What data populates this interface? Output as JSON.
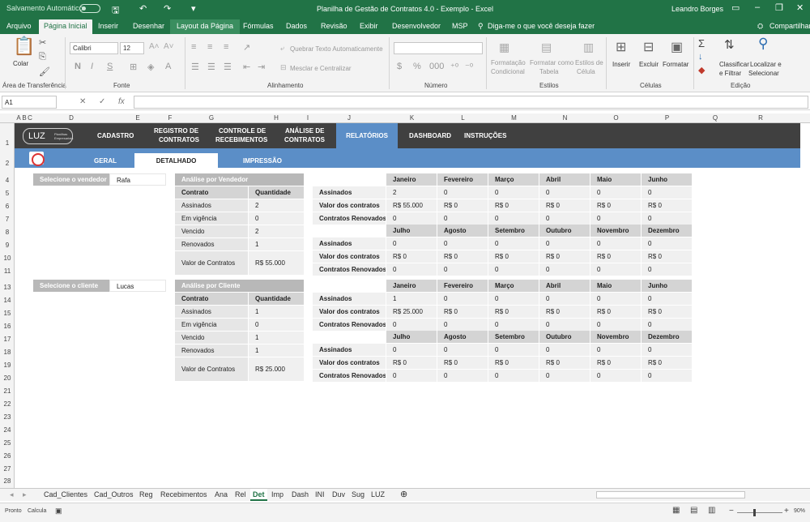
{
  "titlebar": {
    "autosave": "Salvamento Automático",
    "title": "Planilha de Gestão de Contratos 4.0 - Exemplo  -  Excel",
    "user": "Leandro Borges"
  },
  "tabs": [
    "Arquivo",
    "Página Inicial",
    "Inserir",
    "Desenhar",
    "Layout da Página",
    "Fórmulas",
    "Dados",
    "Revisão",
    "Exibir",
    "Desenvolvedor",
    "MSP"
  ],
  "search": "Diga-me o que você deseja fazer",
  "share": "Compartilhar",
  "ribbon": {
    "paste": "Colar",
    "clipboard": "Área de Transferência",
    "font_name": "Calibri",
    "font_size": "12",
    "font_group": "Fonte",
    "wrap": "Quebrar Texto Automaticamente",
    "merge": "Mesclar e Centralizar",
    "align_group": "Alinhamento",
    "number_group": "Número",
    "cond_format_1": "Formatação",
    "cond_format_2": "Condicional",
    "format_table_1": "Formatar como",
    "format_table_2": "Tabela",
    "cell_styles_1": "Estilos de",
    "cell_styles_2": "Célula",
    "styles_group": "Estilos",
    "insert": "Inserir",
    "delete": "Excluir",
    "format": "Formatar",
    "cells_group": "Células",
    "sort_1": "Classificar",
    "sort_2": "e Filtrar",
    "find_1": "Localizar e",
    "find_2": "Selecionar",
    "edit_group": "Edição"
  },
  "namebox": "A1",
  "columns": [
    "A",
    "B",
    "C",
    "D",
    "E",
    "F",
    "G",
    "H",
    "I",
    "J",
    "K",
    "L",
    "M",
    "N",
    "O",
    "P",
    "Q",
    "R"
  ],
  "rows": [
    "1",
    "2",
    "4",
    "5",
    "6",
    "7",
    "8",
    "9",
    "10",
    "11",
    "13",
    "14",
    "15",
    "16",
    "17",
    "18",
    "19",
    "20",
    "21",
    "22",
    "23",
    "24",
    "25",
    "26",
    "27",
    "28",
    "29",
    "30"
  ],
  "nav": {
    "logo": "LUZ",
    "logo_sub": "Planilhas Empresariais",
    "cadastro": "CADASTRO",
    "registro_1": "REGISTRO DE",
    "registro_2": "CONTRATOS",
    "controle_1": "CONTROLE DE",
    "controle_2": "RECEBIMENTOS",
    "analise_1": "ANÁLISE DE",
    "analise_2": "CONTRATOS",
    "relatorios": "RELATÓRIOS",
    "dashboard": "DASHBOARD",
    "instrucoes": "INSTRUÇÕES"
  },
  "subnav": {
    "geral": "GERAL",
    "detalhado": "DETALHADO",
    "impressao": "IMPRESSÃO"
  },
  "sel_vendor_label": "Selecione o vendedor",
  "sel_vendor_value": "Rafa",
  "sel_client_label": "Selecione o cliente",
  "sel_client_value": "Lucas",
  "vendor_table": {
    "title": "Análise por Vendedor",
    "h1": "Contrato",
    "h2": "Quantidade",
    "rows": [
      [
        "Assinados",
        "2"
      ],
      [
        "Em vigência",
        "0"
      ],
      [
        "Vencido",
        "2"
      ],
      [
        "Renovados",
        "1"
      ]
    ],
    "valor_label": "Valor de Contratos",
    "valor": "R$ 55.000"
  },
  "client_table": {
    "title": "Análise por Cliente",
    "h1": "Contrato",
    "h2": "Quantidade",
    "rows": [
      [
        "Assinados",
        "1"
      ],
      [
        "Em vigência",
        "0"
      ],
      [
        "Vencido",
        "1"
      ],
      [
        "Renovados",
        "1"
      ]
    ],
    "valor_label": "Valor de Contratos",
    "valor": "R$ 25.000"
  },
  "months_1": [
    "Janeiro",
    "Fevereiro",
    "Março",
    "Abril",
    "Maio",
    "Junho"
  ],
  "months_2": [
    "Julho",
    "Agosto",
    "Setembro",
    "Outubro",
    "Novembro",
    "Dezembro"
  ],
  "metric_labels": [
    "Assinados",
    "Valor dos contratos",
    "Contratos Renovados"
  ],
  "vendor_h1": [
    [
      "2",
      "0",
      "0",
      "0",
      "0",
      "0"
    ],
    [
      "R$ 55.000",
      "R$ 0",
      "R$ 0",
      "R$ 0",
      "R$ 0",
      "R$ 0"
    ],
    [
      "0",
      "0",
      "0",
      "0",
      "0",
      "0"
    ]
  ],
  "vendor_h2": [
    [
      "0",
      "0",
      "0",
      "0",
      "0",
      "0"
    ],
    [
      "R$ 0",
      "R$ 0",
      "R$ 0",
      "R$ 0",
      "R$ 0",
      "R$ 0"
    ],
    [
      "0",
      "0",
      "0",
      "0",
      "0",
      "0"
    ]
  ],
  "client_h1": [
    [
      "1",
      "0",
      "0",
      "0",
      "0",
      "0"
    ],
    [
      "R$ 25.000",
      "R$ 0",
      "R$ 0",
      "R$ 0",
      "R$ 0",
      "R$ 0"
    ],
    [
      "0",
      "0",
      "0",
      "0",
      "0",
      "0"
    ]
  ],
  "client_h2": [
    [
      "0",
      "0",
      "0",
      "0",
      "0",
      "0"
    ],
    [
      "R$ 0",
      "R$ 0",
      "R$ 0",
      "R$ 0",
      "R$ 0",
      "R$ 0"
    ],
    [
      "0",
      "0",
      "0",
      "0",
      "0",
      "0"
    ]
  ],
  "sheets": [
    "Cad_Clientes",
    "Cad_Outros",
    "Reg",
    "Recebimentos",
    "Ana",
    "Rel",
    "Det",
    "Imp",
    "Dash",
    "INI",
    "Duv",
    "Sug",
    "LUZ"
  ],
  "active_sheet": "Det",
  "status": {
    "ready": "Pronto",
    "calc": "Calcula",
    "zoom": "90%"
  }
}
